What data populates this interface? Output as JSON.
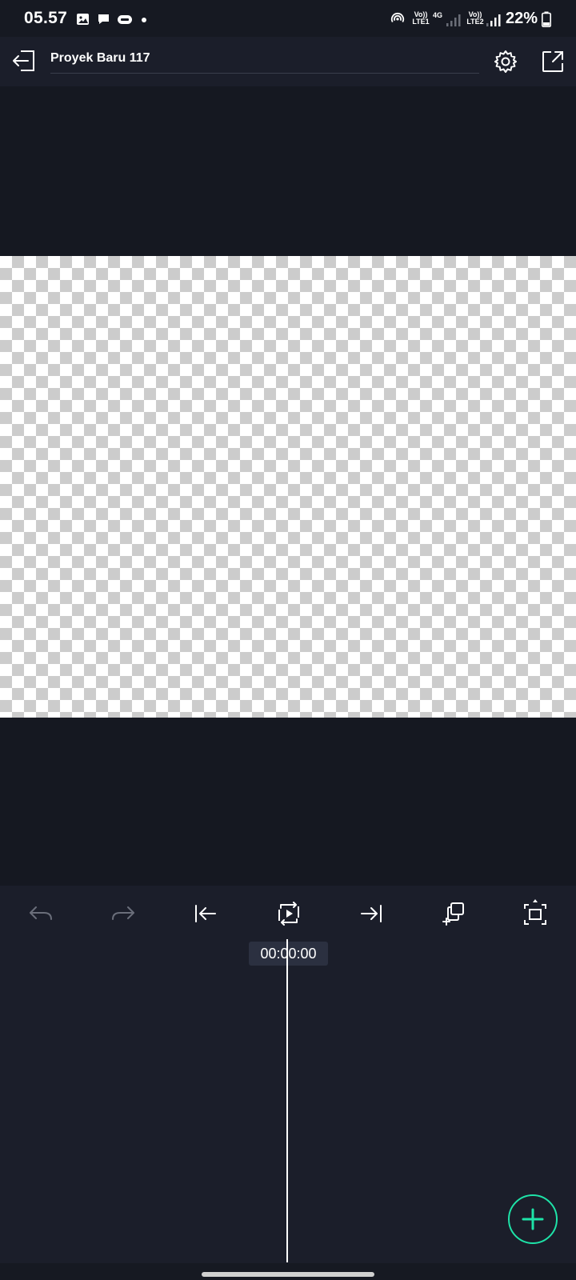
{
  "status_bar": {
    "time": "05.57",
    "battery": "22%",
    "net1_label_top": "Vo))",
    "net1_label_bottom": "LTE1",
    "net_type": "4G",
    "net2_label_top": "Vo))",
    "net2_label_bottom": "LTE2",
    "icons": [
      "gallery-icon",
      "chat-icon",
      "app-badge-icon",
      "dot-icon",
      "hotspot-icon",
      "signal-icon",
      "battery-icon"
    ]
  },
  "top_bar": {
    "title": "Proyek Baru 117",
    "icons": [
      "exit-icon",
      "gear-icon",
      "share-icon"
    ]
  },
  "toolbar": {
    "icons": [
      "undo-icon",
      "redo-icon",
      "jump-start-icon",
      "play-preview-icon",
      "jump-end-icon",
      "add-layer-icon",
      "fullscreen-icon"
    ]
  },
  "timeline": {
    "timecode": "00:00:00"
  },
  "colors": {
    "accent": "#1ee3a8",
    "background": "#1b1e2a",
    "preview_background": "#151821"
  }
}
